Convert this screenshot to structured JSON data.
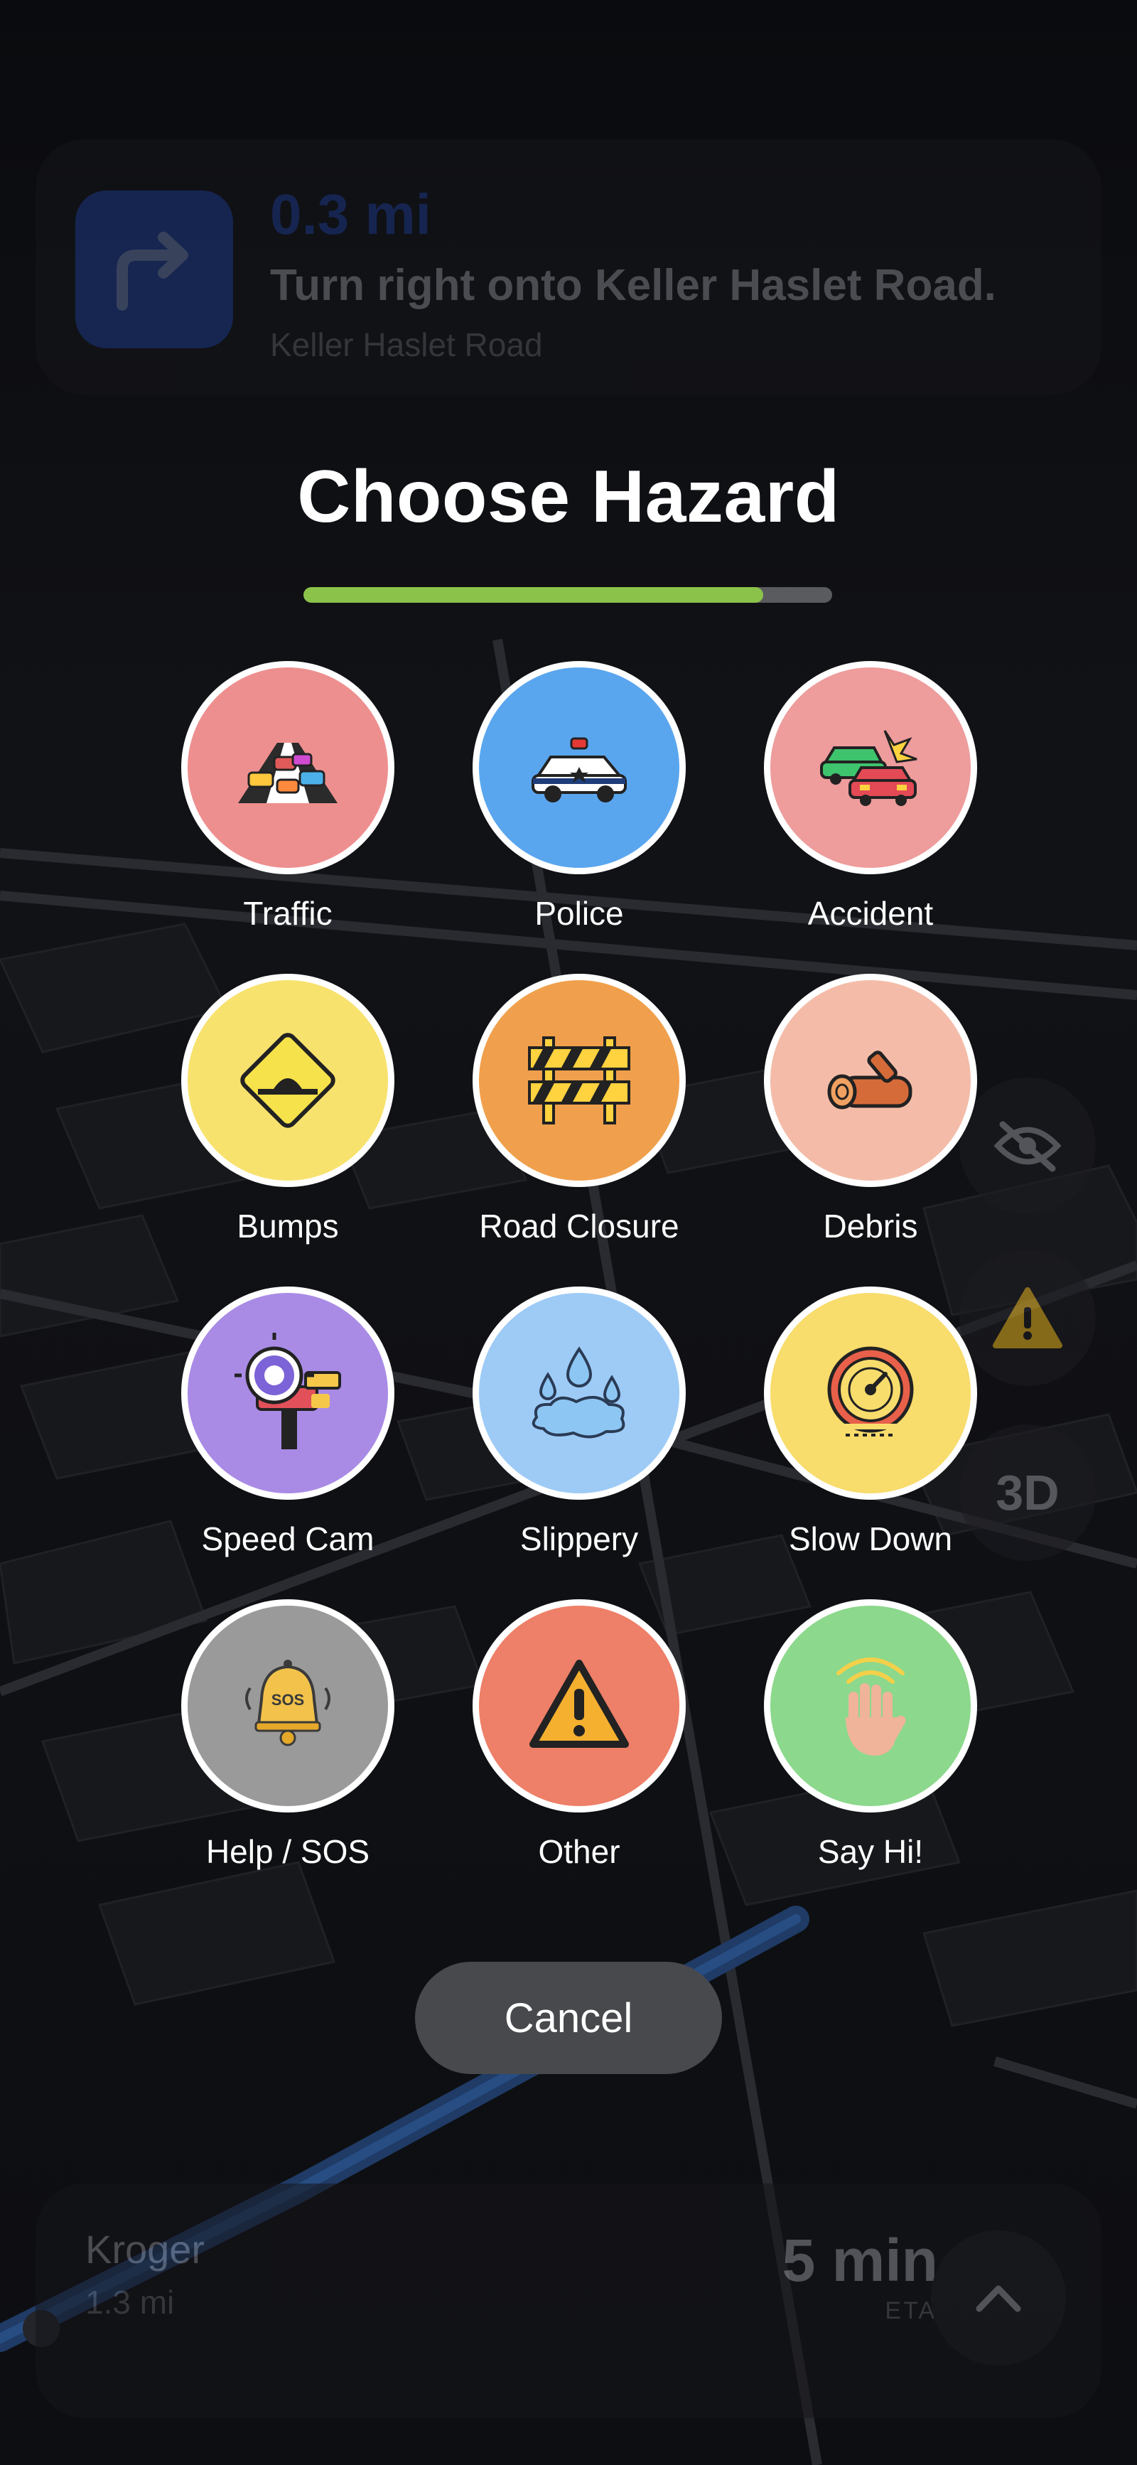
{
  "navigation": {
    "distance": "0.3 mi",
    "instruction": "Turn right onto Keller Haslet Road.",
    "street": "Keller Haslet Road",
    "turn_icon": "turn-right-arrow"
  },
  "map_controls": {
    "hide_icon": "eye-slash",
    "report_icon": "warning-triangle",
    "view_label": "3D"
  },
  "sheet": {
    "title": "Choose Hazard",
    "progress": 0.87,
    "colors": {
      "progress_fill": "#8bc34a",
      "progress_track": "#5a5b5f"
    },
    "hazards": [
      {
        "label": "Traffic",
        "icon": "traffic-jam",
        "color": "#ee8f8f"
      },
      {
        "label": "Police",
        "icon": "police-car",
        "color": "#5aa6ee"
      },
      {
        "label": "Accident",
        "icon": "car-crash",
        "color": "#ee9c9c"
      },
      {
        "label": "Bumps",
        "icon": "bump-sign",
        "color": "#f8e26e"
      },
      {
        "label": "Road Closure",
        "icon": "road-barrier",
        "color": "#f0a04c"
      },
      {
        "label": "Debris",
        "icon": "log",
        "color": "#f4bca8"
      },
      {
        "label": "Speed Cam",
        "icon": "speed-camera",
        "color": "#a98be6"
      },
      {
        "label": "Slippery",
        "icon": "water-puddle",
        "color": "#9ecbf6"
      },
      {
        "label": "Slow Down",
        "icon": "speedometer",
        "color": "#f8dc6c"
      },
      {
        "label": "Help / SOS",
        "icon": "sos-bell",
        "color": "#9a9a9a"
      },
      {
        "label": "Other",
        "icon": "warning-triangle",
        "color": "#ee7f68"
      },
      {
        "label": "Say Hi!",
        "icon": "waving-hand",
        "color": "#8cd88c"
      }
    ],
    "cancel_label": "Cancel"
  },
  "trip": {
    "destination": "Kroger",
    "distance": "1.3 mi",
    "eta_value": "5 min",
    "eta_label": "ETA",
    "expand_icon": "chevron-up"
  }
}
